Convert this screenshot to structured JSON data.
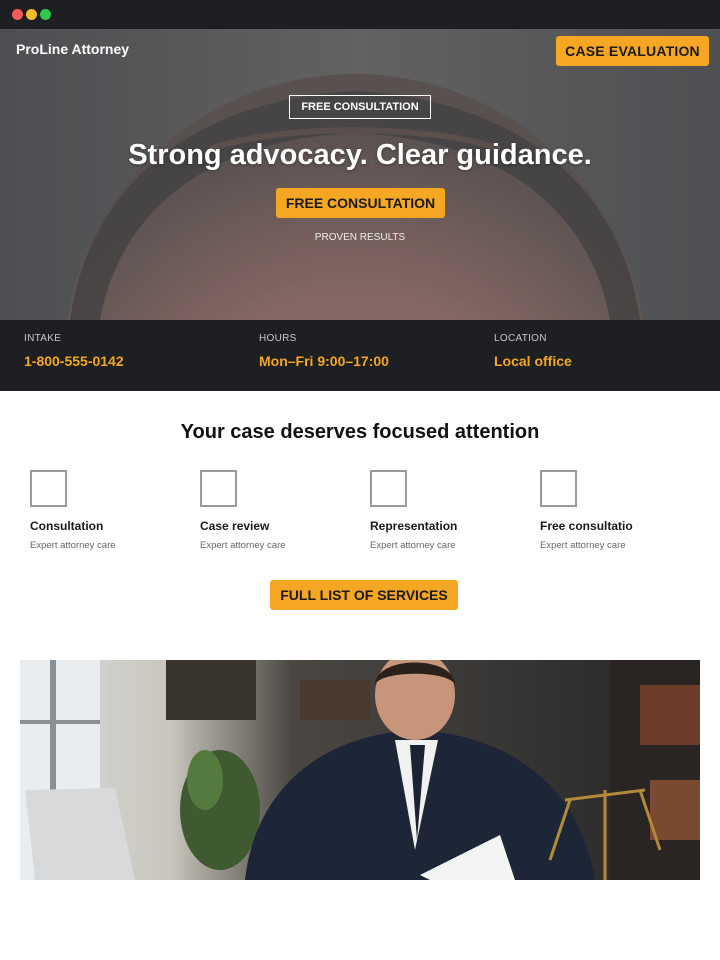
{
  "header": {
    "brand": "ProLine Attorney",
    "cta_label": "CASE EVALUATION"
  },
  "hero": {
    "tag": "FREE CONSULTATION",
    "headline": "Strong advocacy. Clear guidance.",
    "cta_label": "FREE CONSULTATION",
    "subtext": "PROVEN RESULTS"
  },
  "info": [
    {
      "label": "INTAKE",
      "value": "1-800-555-0142"
    },
    {
      "label": "HOURS",
      "value": "Mon–Fri 9:00–17:00"
    },
    {
      "label": "LOCATION",
      "value": "Local office"
    }
  ],
  "services": {
    "title": "Your case deserves focused attention",
    "items": [
      {
        "name": "Consultation",
        "desc": "Expert attorney care"
      },
      {
        "name": "Case review",
        "desc": "Expert attorney care"
      },
      {
        "name": "Representation",
        "desc": "Expert attorney care"
      },
      {
        "name": "Free consultation",
        "desc": "Expert attorney care"
      }
    ],
    "cta_label": "FULL LIST OF SERVICES"
  },
  "colors": {
    "accent": "#f5a623",
    "dark_bar": "#1d1f22"
  }
}
